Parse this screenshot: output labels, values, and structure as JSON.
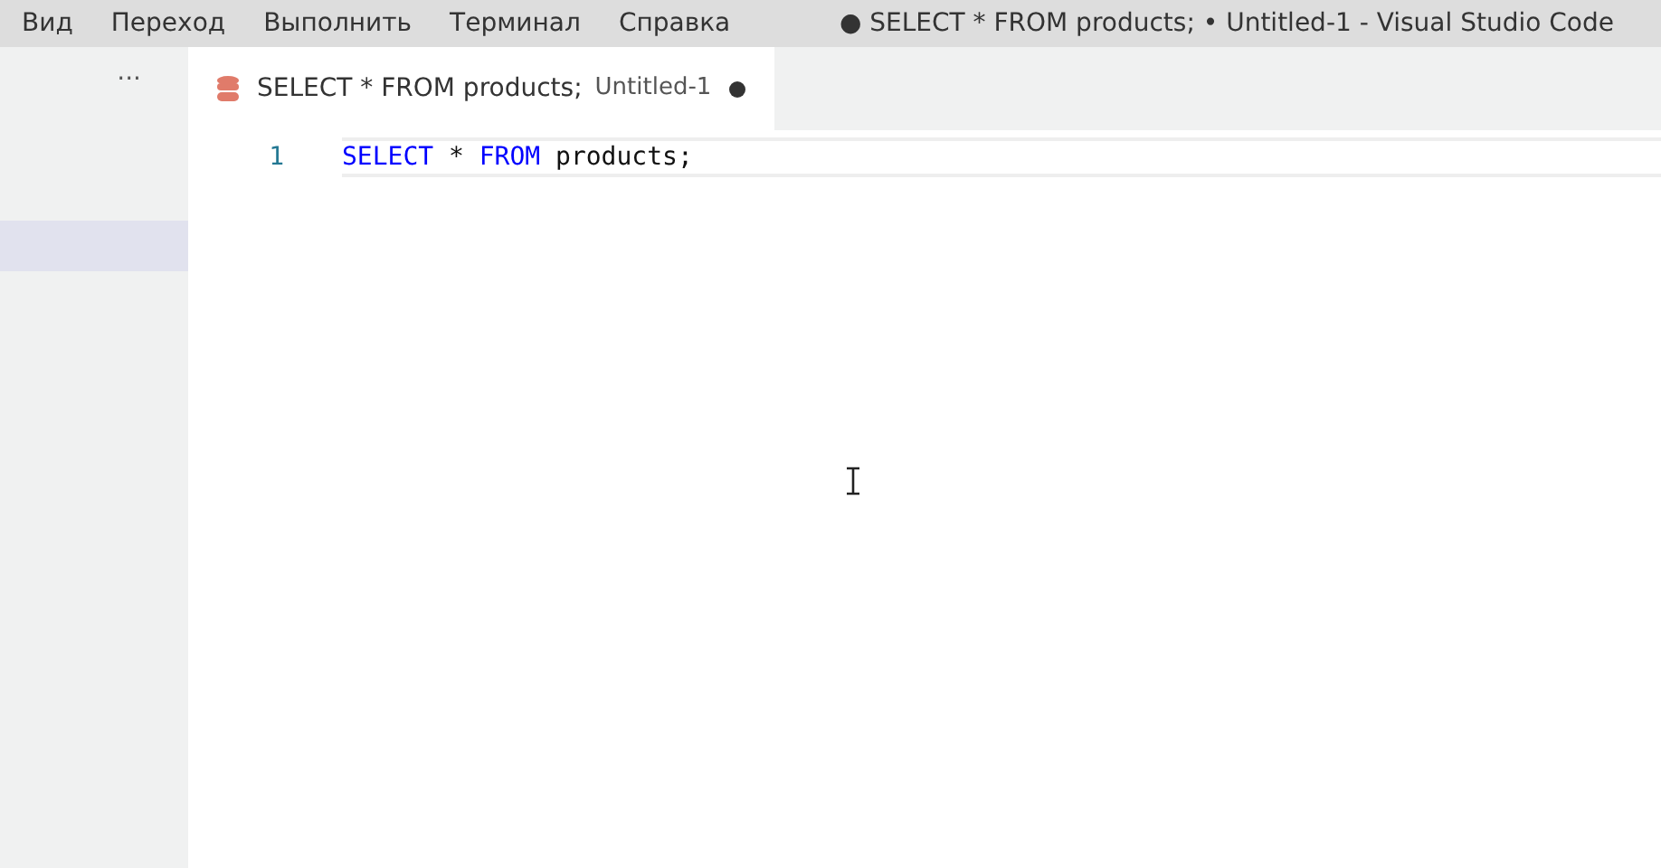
{
  "menu": [
    "Вид",
    "Переход",
    "Выполнить",
    "Терминал",
    "Справка"
  ],
  "window": {
    "title": "● SELECT * FROM products; • Untitled-1 - Visual Studio Code"
  },
  "sidebar": {
    "more": "···"
  },
  "tabs": [
    {
      "label": "SELECT * FROM products;",
      "description": "Untitled-1",
      "modified": true,
      "selected": true
    }
  ],
  "editor": {
    "lines": [
      {
        "number": "1",
        "current": true,
        "tokens": [
          {
            "kind": "keyword",
            "text": "SELECT"
          },
          {
            "kind": "text",
            "text": " * "
          },
          {
            "kind": "keyword",
            "text": "FROM"
          },
          {
            "kind": "text",
            "text": " products;"
          }
        ]
      }
    ]
  }
}
